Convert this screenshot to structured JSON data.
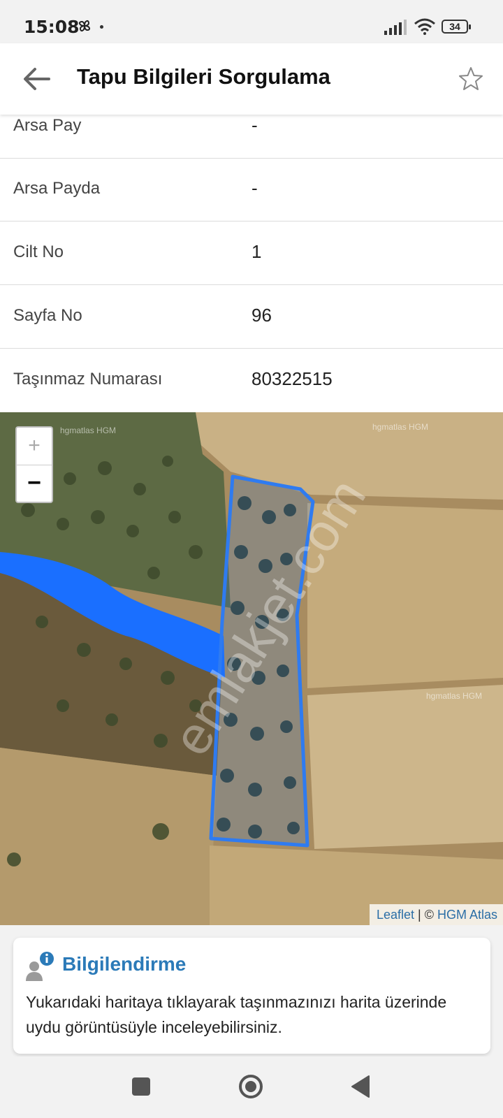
{
  "status": {
    "time": "15:08",
    "battery": "34"
  },
  "header": {
    "title": "Tapu Bilgileri Sorgulama"
  },
  "rows": [
    {
      "label": "Arsa Pay",
      "value": "-"
    },
    {
      "label": "Arsa Payda",
      "value": "-"
    },
    {
      "label": "Cilt No",
      "value": "1"
    },
    {
      "label": "Sayfa No",
      "value": "96"
    },
    {
      "label": "Taşınmaz Numarası",
      "value": "80322515"
    }
  ],
  "map": {
    "zoom_in": "+",
    "zoom_out": "−",
    "attribution_link": "Leaflet",
    "attribution_sep": " | © ",
    "attribution_source": "HGM Atlas",
    "watermark": "emlakjet.com",
    "tile_labels": [
      "hgmatlas HGM",
      "hgmatlas HGM",
      "hgmatlas HGM"
    ],
    "parcel_color": "#2f7bf0",
    "river_color": "#1a6fff"
  },
  "info": {
    "title": "Bilgilendirme",
    "text": "Yukarıdaki haritaya tıklayarak taşınmazınızı harita üzerinde uydu görüntüsüyle inceleyebilirsiniz."
  }
}
